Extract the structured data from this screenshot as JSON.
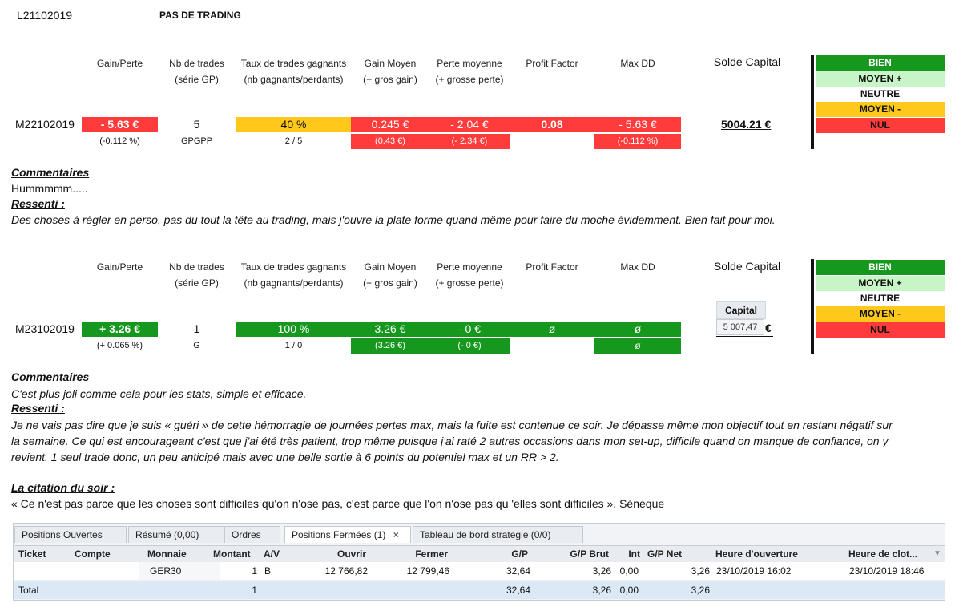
{
  "top": {
    "date_label": "L21102019",
    "status": "PAS DE TRADING"
  },
  "headers": {
    "gain_perte": "Gain/Perte",
    "nb_trades_1": "Nb de trades",
    "nb_trades_2": "(série GP)",
    "taux_1": "Taux de trades gagnants",
    "taux_2": "(nb gagnants/perdants)",
    "gain_moyen_1": "Gain Moyen",
    "gain_moyen_2": "(+ gros gain)",
    "perte_moy_1": "Perte moyenne",
    "perte_moy_2": "(+ grosse perte)",
    "profit_factor": "Profit Factor",
    "max_dd": "Max DD",
    "solde_capital": "Solde Capital"
  },
  "legend": {
    "bien": "BIEN",
    "moyen_plus": "MOYEN +",
    "neutre": "NEUTRE",
    "moyen_moins": "MOYEN -",
    "nul": "NUL"
  },
  "day1": {
    "label": "M22102019",
    "gain": "- 5.63 €",
    "gain_pct": "(-0.112 %)",
    "nb": "5",
    "serie": "GPGPP",
    "taux": "40 %",
    "ratio": "2 / 5",
    "gain_moyen": "0.245 €",
    "gros_gain": "(0.43 €)",
    "perte_moy": "- 2.04 €",
    "grosse_perte": "(- 2.34 €)",
    "pf": "0.08",
    "dd": "- 5.63 €",
    "dd_pct": "(-0.112 %)",
    "solde": "5004.21 €",
    "commentaires_title": "Commentaires",
    "commentaires": "Hummmmm.....",
    "ressenti_title": "Ressenti :",
    "ressenti": "Des choses à régler en perso, pas du tout la tête au trading, mais j'ouvre la plate forme quand même pour faire du moche évidemment. Bien fait pour moi."
  },
  "day2": {
    "label": "M23102019",
    "gain": "+ 3.26 €",
    "gain_pct": "(+ 0.065 %)",
    "nb": "1",
    "serie": "G",
    "taux": "100 %",
    "ratio": "1 / 0",
    "gain_moyen": "3.26 €",
    "gros_gain": "(3.26 €)",
    "perte_moy": "- 0 €",
    "grosse_perte": "(- 0 €)",
    "pf": "ø",
    "dd": "ø",
    "dd2": "ø",
    "capital_label": "Capital",
    "capital_value": "5 007,47",
    "capital_euro": "€",
    "commentaires_title": "Commentaires",
    "commentaires": "C'est plus joli comme cela pour les stats, simple et efficace.",
    "ressenti_title": "Ressenti :",
    "ressenti_1": "Je ne vais pas dire que je suis « guéri » de cette hémorragie de journées pertes max, mais la fuite est contenue ce soir. Je dépasse même mon objectif tout en restant négatif sur",
    "ressenti_2": "la semaine. Ce qui est encourageant c'est que j'ai été très patient, trop même puisque j'ai raté 2 autres occasions dans mon set-up, difficile quand on manque de confiance, on y",
    "ressenti_3": "revient. 1 seul trade donc, un peu anticipé mais avec une belle sortie à 6 points du potentiel max et un RR > 2."
  },
  "citation": {
    "title": "La citation du soir :",
    "text": "« Ce n'est pas parce que les choses sont difficiles qu'on n'ose pas, c'est parce que l'on n'ose pas qu 'elles sont difficiles ». Sénèque"
  },
  "panel": {
    "tabs": [
      "Positions Ouvertes",
      "Résumé (0,00)",
      "Ordres",
      "Positions Fermées (1)",
      "Tableau de bord strategie (0/0)"
    ],
    "close_glyph": "×",
    "columns": [
      "Ticket",
      "Compte",
      "Monnaie",
      "Montant",
      "A/V",
      "Ouvrir",
      "Fermer",
      "G/P",
      "G/P Brut",
      "Int",
      "G/P Net",
      "Heure d'ouverture",
      "Heure de clot..."
    ],
    "row": {
      "ticket": "",
      "compte": "",
      "monnaie": "GER30",
      "montant": "1",
      "av": "B",
      "ouvrir": "12 766,82",
      "fermer": "12 799,46",
      "gp": "32,64",
      "gp_brut": "3,26",
      "int": "0,00",
      "gp_net": "3,26",
      "h_ouv": "23/10/2019 16:02",
      "h_clot": "23/10/2019 18:46"
    },
    "total": {
      "label": "Total",
      "montant": "1",
      "gp": "32,64",
      "gp_brut": "3,26",
      "int": "0,00",
      "gp_net": "3,26"
    }
  }
}
